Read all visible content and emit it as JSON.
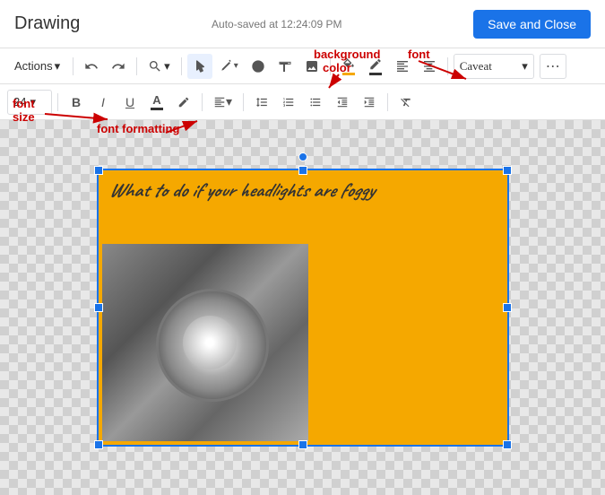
{
  "header": {
    "title": "Drawing",
    "autosave": "Auto-saved at 12:24:09 PM",
    "save_close_label": "Save and Close"
  },
  "toolbar1": {
    "actions_label": "Actions",
    "actions_chevron": "▾",
    "undo_label": "↩",
    "redo_label": "↪",
    "zoom_label": "🔍",
    "zoom_chevron": "▾",
    "select_icon": "◻",
    "line_icon": "╱",
    "shape_icon": "○",
    "text_icon": "⊡",
    "image_icon": "🖼",
    "background_color_icon": "⬛",
    "line_color_icon": "✎",
    "align_left_icon": "≡",
    "align_center_icon": "≡",
    "font_label": "Caveat",
    "font_chevron": "▾",
    "more_icon": "⋯"
  },
  "toolbar2": {
    "font_size": "24",
    "font_size_chevron": "▾",
    "bold_label": "B",
    "italic_label": "I",
    "underline_label": "U",
    "font_color_icon": "A",
    "highlight_icon": "✎",
    "align_icon": "≡",
    "align_chevron": "▾",
    "line_spacing_icon": "≡",
    "ordered_list_icon": "≡",
    "bullet_list_icon": "≡",
    "indent_more_icon": "→",
    "indent_less_icon": "←",
    "clear_format_icon": "✕"
  },
  "canvas": {
    "drawing_title": "What to do if your headlights are foggy"
  },
  "annotations": {
    "font_size_label": "font\nsize",
    "font_formatting_label": "font formatting",
    "background_color_label": "background\ncolor",
    "font_label": "font"
  }
}
